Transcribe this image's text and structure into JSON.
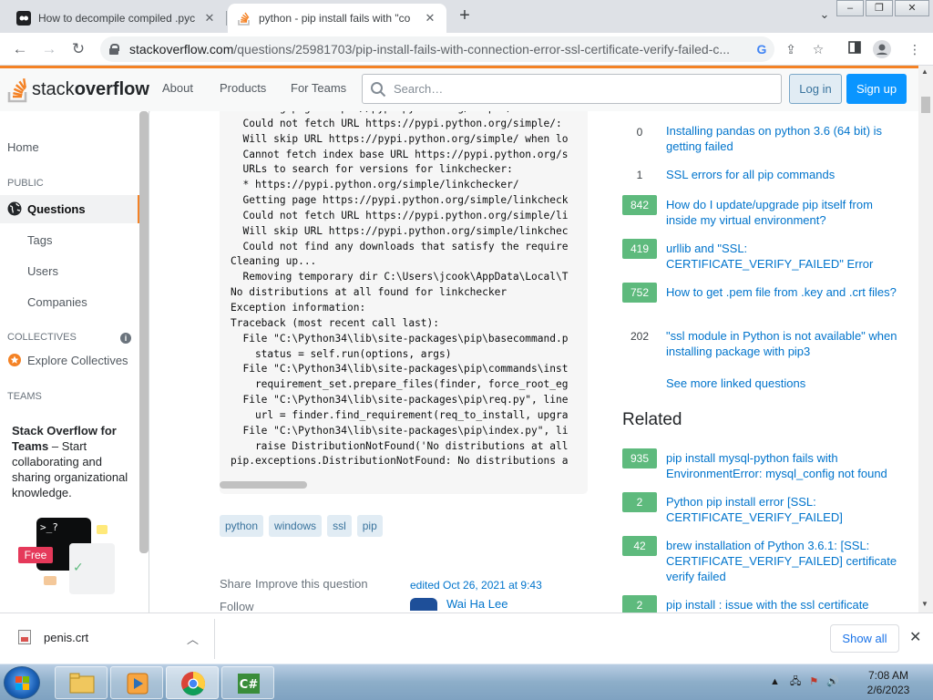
{
  "browser": {
    "tabs": [
      {
        "title": "How to decompile compiled .pyc",
        "active": false
      },
      {
        "title": "python - pip install fails with \"co",
        "active": true
      }
    ],
    "url_host": "stackoverflow.com",
    "url_path": "/questions/25981703/pip-install-fails-with-connection-error-ssl-certificate-verify-failed-c..."
  },
  "so_header": {
    "logo_light": "stack",
    "logo_bold": "overflow",
    "nav": [
      "About",
      "Products",
      "For Teams"
    ],
    "search_placeholder": "Search…",
    "login": "Log in",
    "signup": "Sign up"
  },
  "sidebar": {
    "home": "Home",
    "public_heading": "PUBLIC",
    "questions": "Questions",
    "tags": "Tags",
    "users": "Users",
    "companies": "Companies",
    "collectives_heading": "COLLECTIVES",
    "explore_collectives": "Explore Collectives",
    "teams_heading": "TEAMS",
    "teams_title": "Stack Overflow for Teams",
    "teams_text": " – Start collaborating and sharing organizational knowledge.",
    "free_badge": "Free"
  },
  "code_lines": [
    "  Getting page https://pypi.python.org/simple/",
    "  Could not fetch URL https://pypi.python.org/simple/: ",
    "  Will skip URL https://pypi.python.org/simple/ when lo",
    "  Cannot fetch index base URL https://pypi.python.org/s",
    "  URLs to search for versions for linkchecker:",
    "  * https://pypi.python.org/simple/linkchecker/",
    "  Getting page https://pypi.python.org/simple/linkcheck",
    "  Could not fetch URL https://pypi.python.org/simple/li",
    "  Will skip URL https://pypi.python.org/simple/linkchec",
    "  Could not find any downloads that satisfy the require",
    "Cleaning up...",
    "  Removing temporary dir C:\\Users\\jcook\\AppData\\Local\\T",
    "No distributions at all found for linkchecker",
    "Exception information:",
    "Traceback (most recent call last):",
    "  File \"C:\\Python34\\lib\\site-packages\\pip\\basecommand.p",
    "    status = self.run(options, args)",
    "  File \"C:\\Python34\\lib\\site-packages\\pip\\commands\\inst",
    "    requirement_set.prepare_files(finder, force_root_eg",
    "  File \"C:\\Python34\\lib\\site-packages\\pip\\req.py\", line",
    "    url = finder.find_requirement(req_to_install, upgra",
    "  File \"C:\\Python34\\lib\\site-packages\\pip\\index.py\", li",
    "    raise DistributionNotFound('No distributions at all",
    "pip.exceptions.DistributionNotFound: No distributions a"
  ],
  "post": {
    "tags": [
      "python",
      "windows",
      "ssl",
      "pip"
    ],
    "share": "Share",
    "improve": "Improve this question",
    "follow": "Follow",
    "edited": "edited Oct 26, 2021 at 9:43",
    "editor": "Wai Ha Lee"
  },
  "linked": [
    {
      "score": "0",
      "title": "Installing pandas on python 3.6 (64 bit) is getting failed",
      "accepted": false
    },
    {
      "score": "1",
      "title": "SSL errors for all pip commands",
      "accepted": false
    },
    {
      "score": "842",
      "title": "How do I update/upgrade pip itself from inside my virtual environment?",
      "accepted": true
    },
    {
      "score": "419",
      "title": "urllib and \"SSL: CERTIFICATE_VERIFY_FAILED\" Error",
      "accepted": true
    },
    {
      "score": "752",
      "title": "How to get .pem file from .key and .crt files?",
      "accepted": true
    },
    {
      "score": "202",
      "title": "\"ssl module in Python is not available\" when installing package with pip3",
      "accepted": false
    }
  ],
  "see_more": "See more linked questions",
  "related_heading": "Related",
  "related": [
    {
      "score": "935",
      "title": "pip install mysql-python fails with EnvironmentError: mysql_config not found"
    },
    {
      "score": "2",
      "title": "Python pip install error [SSL: CERTIFICATE_VERIFY_FAILED]"
    },
    {
      "score": "42",
      "title": "brew installation of Python 3.6.1: [SSL: CERTIFICATE_VERIFY_FAILED] certificate verify failed"
    },
    {
      "score": "2",
      "title": "pip install : issue with the ssl certificate"
    }
  ],
  "download": {
    "filename": "penis.crt",
    "show_all": "Show all"
  },
  "taskbar": {
    "time": "7:08 AM",
    "date": "2/6/2023"
  },
  "colors": {
    "accent_orange": "#f48225",
    "link_blue": "#0074cc",
    "accepted_green": "#5eba7d",
    "signup_blue": "#0a95ff"
  }
}
